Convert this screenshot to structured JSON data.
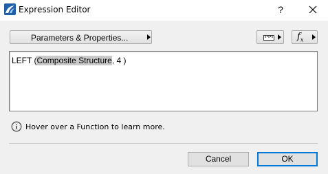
{
  "window": {
    "title": "Expression Editor",
    "help_label": "?"
  },
  "toolbar": {
    "params_label": "Parameters & Properties...",
    "units_icon": "ruler-icon",
    "function_icon": "fx-icon",
    "function_glyph": "f",
    "function_sub": "x"
  },
  "editor": {
    "expr_prefix": "LEFT (",
    "expr_highlight": "Composite Structure",
    "expr_suffix": ", 4 )"
  },
  "info": {
    "icon": "info-icon",
    "text": "Hover over a Function to learn more."
  },
  "buttons": {
    "cancel_label": "Cancel",
    "ok_label": "OK"
  },
  "colors": {
    "accent": "#0078d7",
    "highlight": "#c9c9c9",
    "background": "#f0f0f0"
  }
}
